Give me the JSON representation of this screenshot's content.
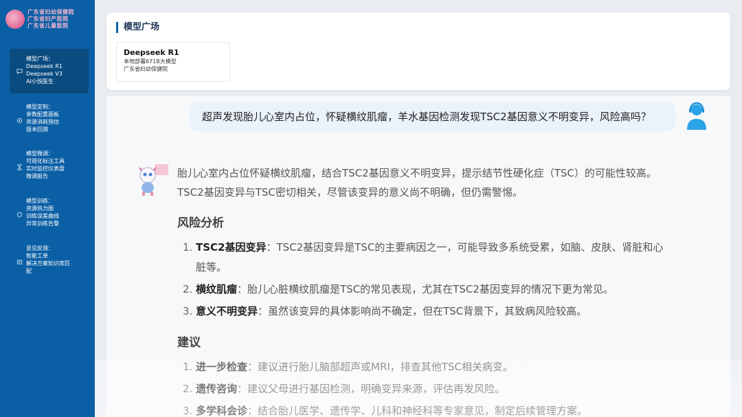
{
  "logo": {
    "lines": [
      "广东省妇幼保健院",
      "广东省妇产医院",
      "广东省儿童医院"
    ]
  },
  "sidebar": {
    "items": [
      {
        "icon": "chat-icon",
        "lines": [
          "模型广场：",
          "Deepseek R1",
          "Deepseek V3",
          "AI小悦医生"
        ],
        "active": true
      },
      {
        "icon": "settings-icon",
        "lines": [
          "模型定制：",
          "参数配置面板",
          "资源消耗预估",
          "版本回溯"
        ],
        "active": false
      },
      {
        "icon": "hourglass-icon",
        "lines": [
          "模型微调：",
          "可视化标注工具",
          "实时监控仪表盘",
          "微调报告"
        ],
        "active": false
      },
      {
        "icon": "training-icon",
        "lines": [
          "模型训练：",
          "资源热力图",
          "训练误差曲线",
          "异常训练告警"
        ],
        "active": false
      },
      {
        "icon": "feedback-icon",
        "lines": [
          "意见反馈：",
          "智能工单",
          "解决方案知识库匹",
          "配"
        ],
        "active": false
      }
    ]
  },
  "model_plaza": {
    "title": "模型广场",
    "model": {
      "name": "Deepseek R1",
      "desc1": "本地部署671B大模型",
      "desc2": "广东省妇幼保健院"
    }
  },
  "chat": {
    "question": "超声发现胎儿心室内占位，怀疑横纹肌瘤，羊水基因检测发现TSC2基因意义不明变异，风险高吗？",
    "intro_line1": "胎儿心室内占位怀疑横纹肌瘤，结合TSC2基因意义不明变异，提示结节性硬化症（TSC）的可能性较高。",
    "intro_line2": "TSC2基因变异与TSC密切相关，尽管该变异的意义尚不明确，但仍需警惕。",
    "risk_heading": "风险分析",
    "risk_items": [
      {
        "num": "1.",
        "term": "TSC2基因变异",
        "text": "：TSC2基因变异是TSC的主要病因之一，可能导致多系统受累，如脑、皮肤、肾脏和心",
        "text2": "脏等。"
      },
      {
        "num": "2.",
        "term": "横纹肌瘤",
        "text": "：胎儿心脏横纹肌瘤是TSC的常见表现，尤其在TSC2基因变异的情况下更为常见。"
      },
      {
        "num": "3.",
        "term": "意义不明变异",
        "text": "：虽然该变异的具体影响尚不确定，但在TSC背景下，其致病风险较高。"
      }
    ],
    "advice_heading": "建议",
    "advice_items": [
      {
        "num": "1.",
        "term": "进一步检查",
        "text": "：建议进行胎儿脑部超声或MRI，排查其他TSC相关病变。"
      },
      {
        "num": "2.",
        "term": "遗传咨询",
        "text": "：建议父母进行基因检测，明确变异来源，评估再发风险。"
      },
      {
        "num": "3.",
        "term": "多学科会诊",
        "text": "：结合胎儿医学、遗传学、儿科和神经科等专家意见，制定后续管理方案。"
      }
    ]
  }
}
